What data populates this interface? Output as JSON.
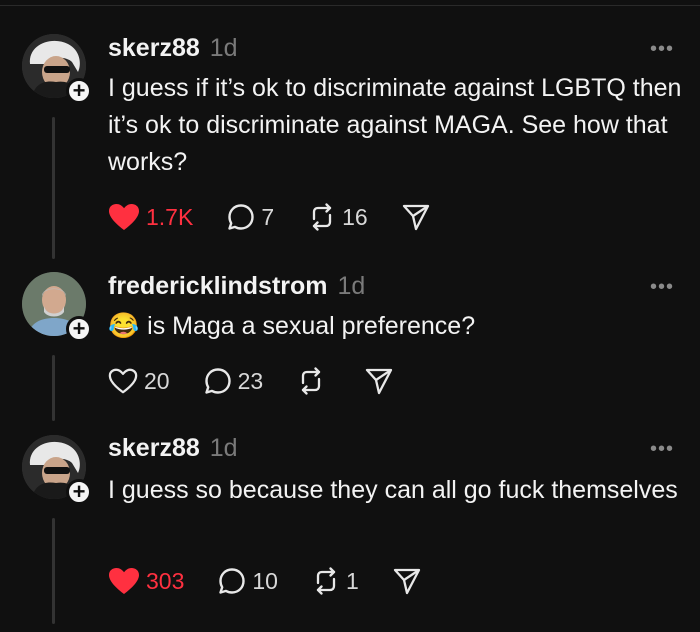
{
  "posts": [
    {
      "username": "skerz88",
      "time": "1d",
      "more": "•••",
      "text": "I guess if it’s ok to discriminate against LGBTQ then it’s ok to discriminate against MAGA. See how that works?",
      "likes": "1.7K",
      "liked": true,
      "replies": "7",
      "reposts": "16",
      "avatar": "grey-haired-man-sunglasses-avatar"
    },
    {
      "username": "fredericklindstrom",
      "time": "1d",
      "more": "•••",
      "emoji": "😂",
      "text": "is Maga a sexual preference?",
      "likes": "20",
      "liked": false,
      "replies": "23",
      "reposts": "",
      "avatar": "grey-bearded-man-avatar"
    },
    {
      "username": "skerz88",
      "time": "1d",
      "more": "•••",
      "text": "I guess so because they can all go fuck themselves",
      "likes": "303",
      "liked": true,
      "replies": "10",
      "reposts": "1",
      "avatar": "grey-haired-man-sunglasses-avatar"
    }
  ],
  "colors": {
    "like": "#ff3040",
    "background": "#101010",
    "muted": "#7a7a7a"
  },
  "icons": [
    "heart-icon",
    "reply-icon",
    "repost-icon",
    "share-icon",
    "more-icon",
    "follow-plus-icon"
  ]
}
